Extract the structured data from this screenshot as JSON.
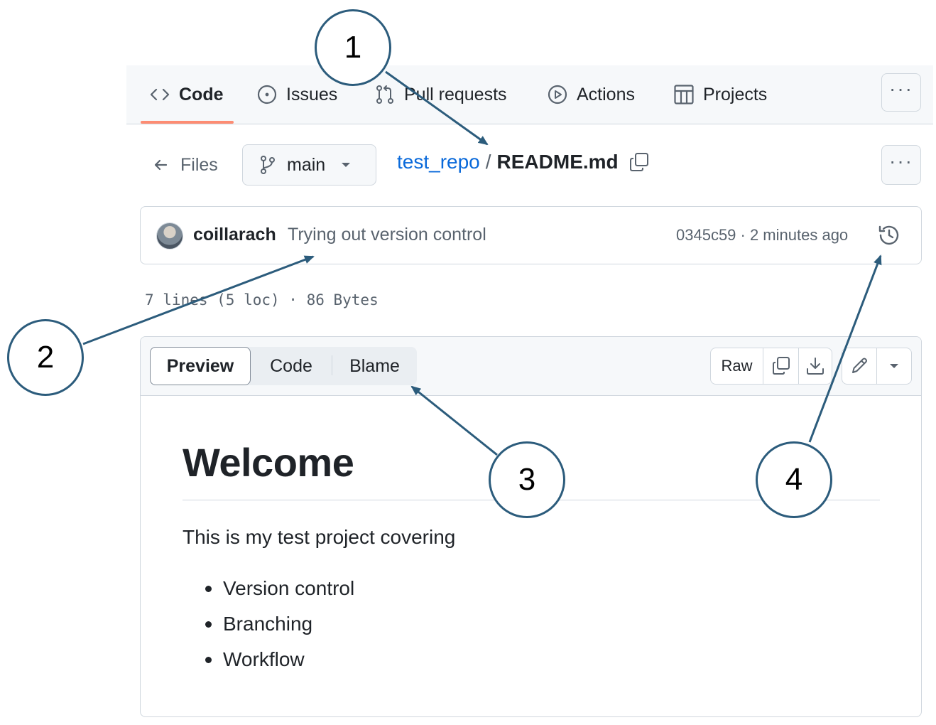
{
  "nav": {
    "tabs": [
      {
        "label": "Code",
        "icon": "code-icon",
        "active": true
      },
      {
        "label": "Issues",
        "icon": "issue-icon"
      },
      {
        "label": "Pull requests",
        "icon": "pull-request-icon"
      },
      {
        "label": "Actions",
        "icon": "play-icon"
      },
      {
        "label": "Projects",
        "icon": "table-icon"
      }
    ],
    "more_label": "···"
  },
  "file_header": {
    "files_label": "Files",
    "branch": "main",
    "repo": "test_repo",
    "separator": "/",
    "file_name": "README.md",
    "more_label": "···"
  },
  "commit": {
    "author": "coillarach",
    "message": "Trying out version control",
    "sha_time": "0345c59 · 2 minutes ago"
  },
  "file_info": "7 lines (5 loc) · 86 Bytes",
  "viewer": {
    "tabs": [
      "Preview",
      "Code",
      "Blame"
    ],
    "raw_label": "Raw"
  },
  "markdown": {
    "heading": "Welcome",
    "paragraph": "This is my test project covering",
    "items": [
      "Version control",
      "Branching",
      "Workflow"
    ]
  },
  "callouts": [
    "1",
    "2",
    "3",
    "4"
  ],
  "colors": {
    "accent": "#fd8c73",
    "link": "#0969da",
    "callout_stroke": "#2c5c7c"
  }
}
